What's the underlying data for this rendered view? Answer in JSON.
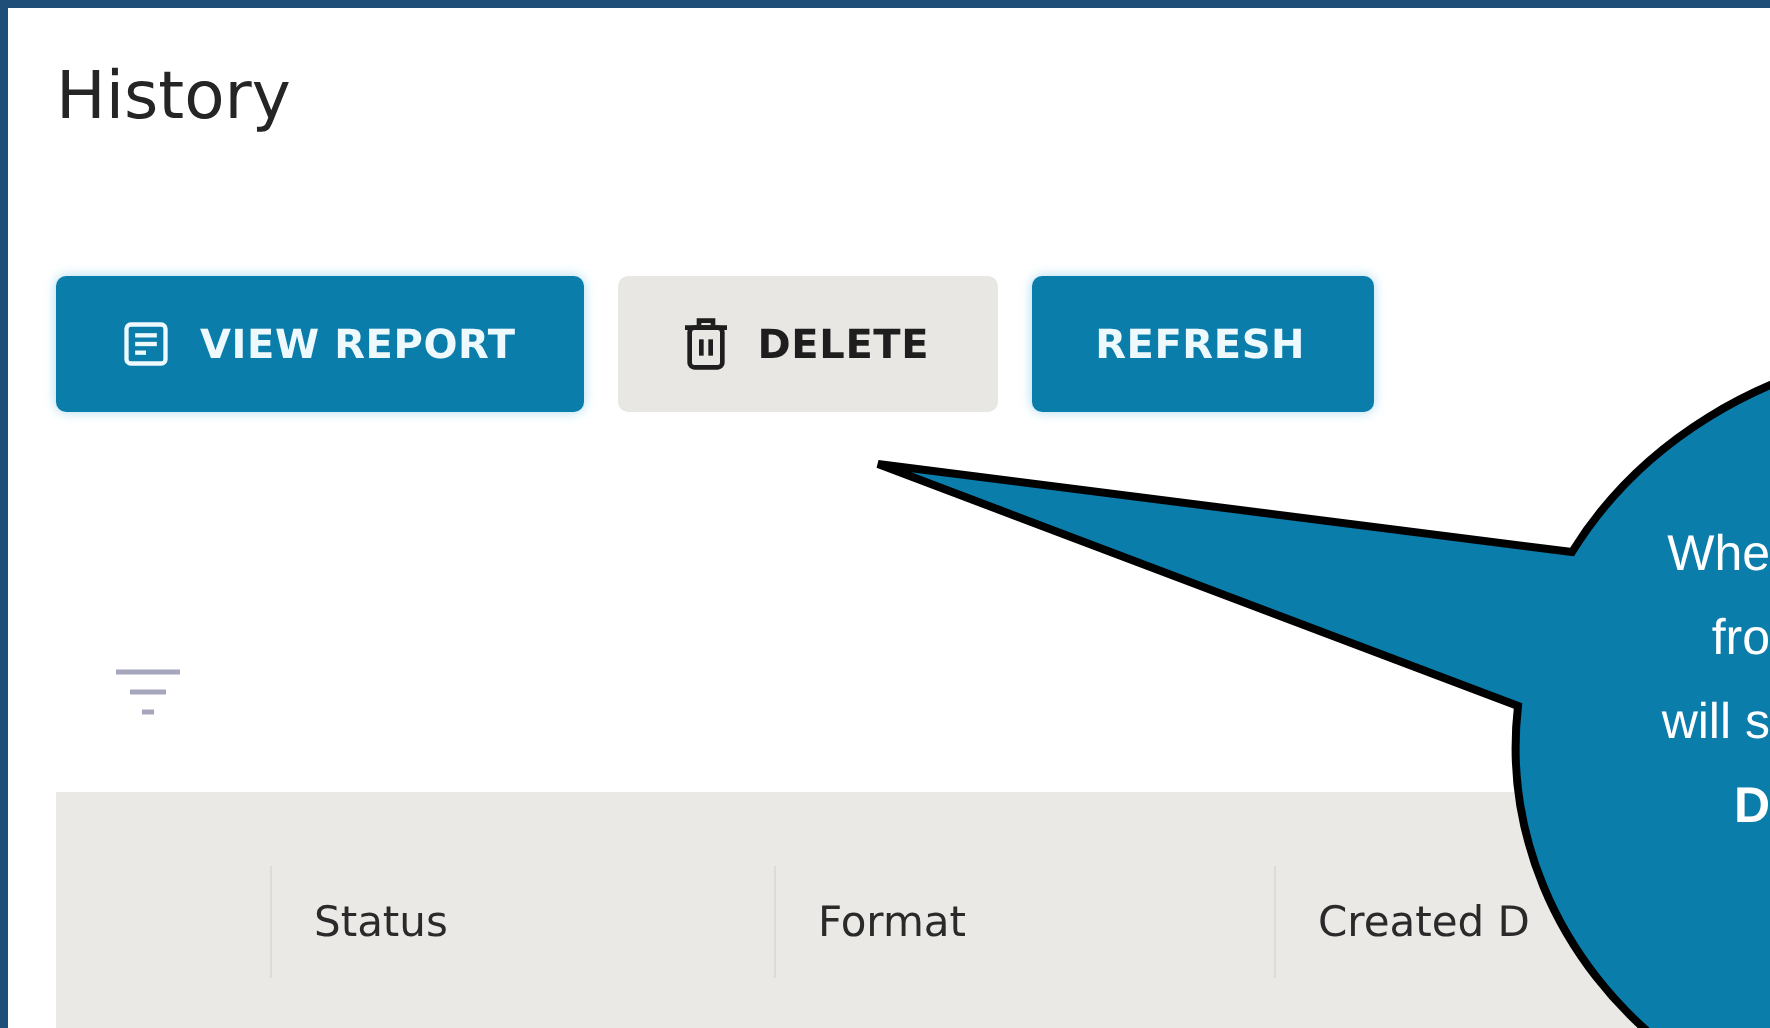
{
  "page": {
    "title": "History"
  },
  "toolbar": {
    "buttons": [
      {
        "label": "VIEW REPORT",
        "kind": "primary"
      },
      {
        "label": "DELETE",
        "kind": "secondary"
      },
      {
        "label": "REFRESH",
        "kind": "primary"
      }
    ]
  },
  "table": {
    "columns": [
      "Status",
      "Format",
      "Created D"
    ]
  },
  "callout": {
    "lines": [
      "Whe",
      "fro",
      "will s",
      "**D**"
    ]
  }
}
